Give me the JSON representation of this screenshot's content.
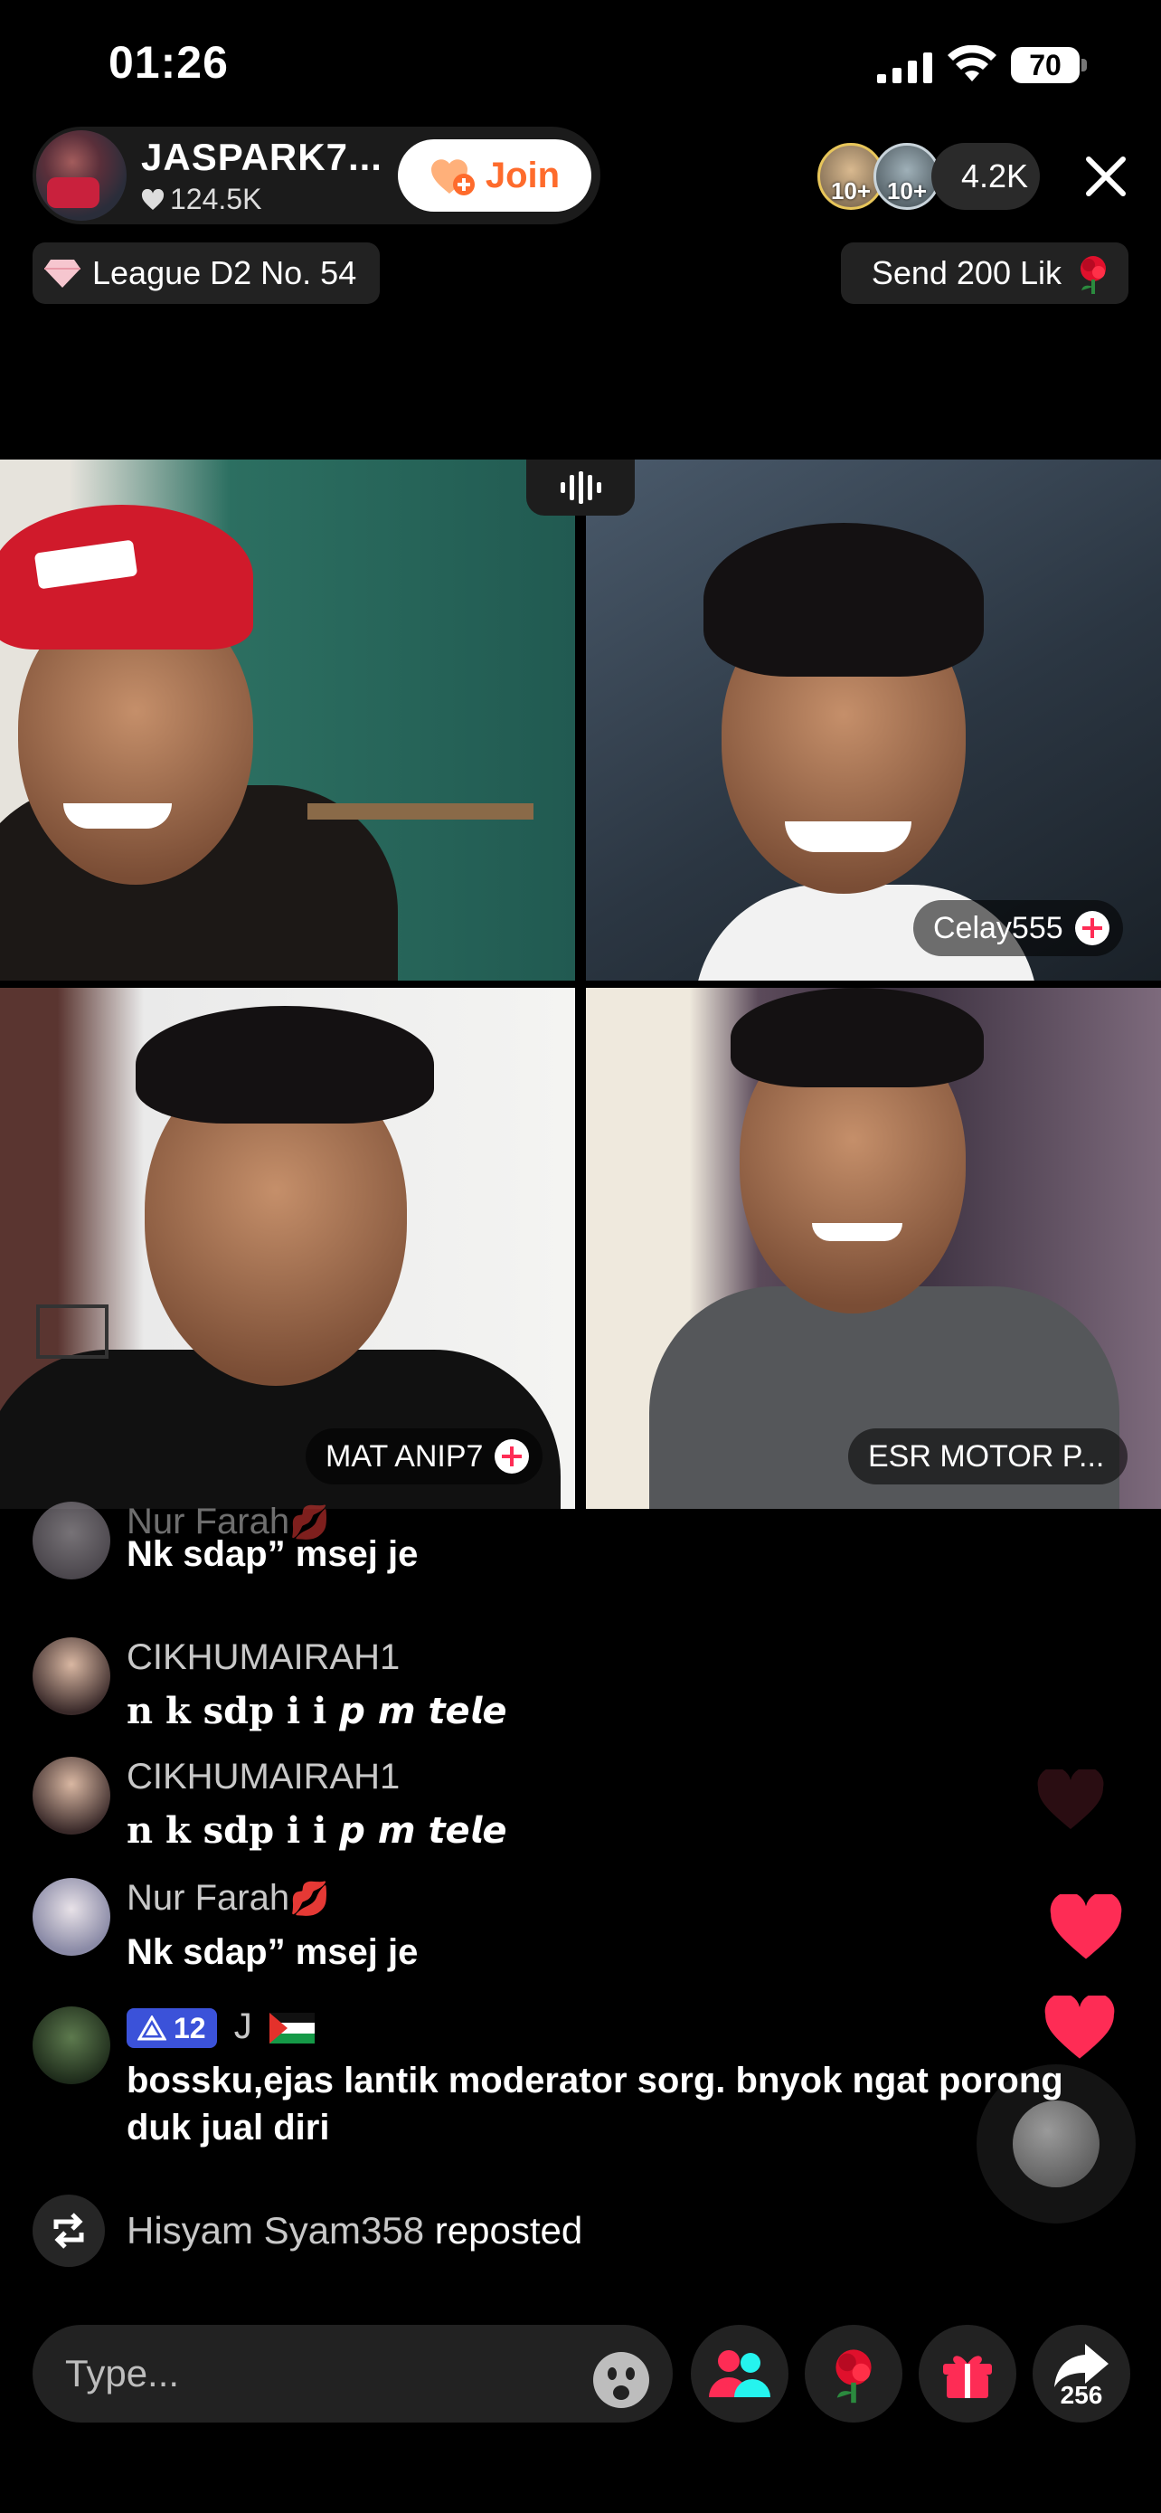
{
  "status_bar": {
    "time": "01:26",
    "battery": "70"
  },
  "host": {
    "name": "JASPARK7...",
    "likes": "124.5K",
    "join_label": "Join"
  },
  "viewers": {
    "badge_1": "10+",
    "badge_2": "10+",
    "count": "4.2K"
  },
  "league_label": "League D2 No. 54",
  "send_label": "Send 200 Lik",
  "guests": [
    {
      "name": "Celay555"
    },
    {
      "name": "MAT ANIP7"
    },
    {
      "name": "ESR MOTOR P..."
    }
  ],
  "comments": [
    {
      "user": "Nur Farah",
      "emoji": "💋",
      "text": "Nk sdap” msej je"
    },
    {
      "user": "CIKHUMAIRAH1",
      "text": "n k sdp i i 𝙥 𝙢 𝙩𝙚𝙡𝙚"
    },
    {
      "user": "CIKHUMAIRAH1",
      "text": "n k sdp i i 𝙥 𝙢 𝙩𝙚𝙡𝙚"
    },
    {
      "user": "Nur Farah",
      "emoji": "💋",
      "text": "Nk sdap” msej je"
    },
    {
      "level": "12",
      "user": "J",
      "text": "bossku,ejas lantik moderator sorg. bnyok ngat porong duk jual diri"
    }
  ],
  "repost": {
    "user": "Hisyam Syam358",
    "action": "reposted"
  },
  "input": {
    "placeholder": "Type..."
  },
  "share_count": "256",
  "colors": {
    "accent": "#fe6b2c",
    "heart": "#fe2c55",
    "badge": "#3b52d9"
  }
}
